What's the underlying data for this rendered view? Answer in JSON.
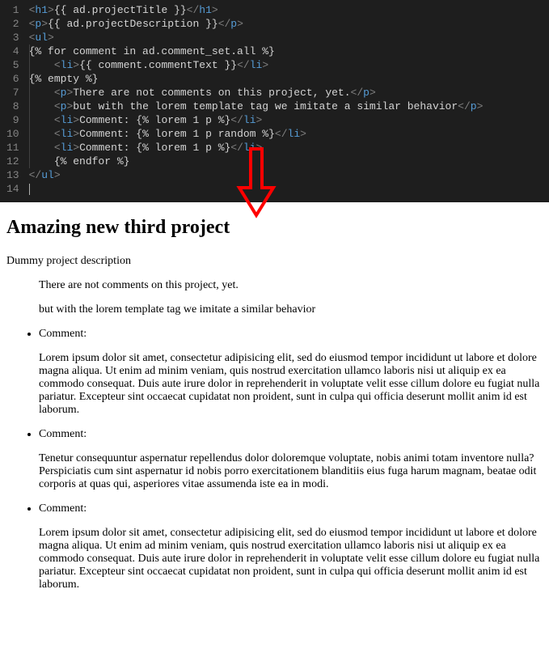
{
  "editor": {
    "lines": [
      [
        {
          "c": "delim",
          "t": "<"
        },
        {
          "c": "tag",
          "t": "h1"
        },
        {
          "c": "delim",
          "t": ">"
        },
        {
          "c": "txt",
          "t": "{{ ad.projectTitle }}"
        },
        {
          "c": "delim",
          "t": "</"
        },
        {
          "c": "tag",
          "t": "h1"
        },
        {
          "c": "delim",
          "t": ">"
        }
      ],
      [
        {
          "c": "delim",
          "t": "<"
        },
        {
          "c": "tag",
          "t": "p"
        },
        {
          "c": "delim",
          "t": ">"
        },
        {
          "c": "txt",
          "t": "{{ ad.projectDescription }}"
        },
        {
          "c": "delim",
          "t": "</"
        },
        {
          "c": "tag",
          "t": "p"
        },
        {
          "c": "delim",
          "t": ">"
        }
      ],
      [
        {
          "c": "delim",
          "t": "<"
        },
        {
          "c": "tag",
          "t": "ul"
        },
        {
          "c": "delim",
          "t": ">"
        }
      ],
      [
        {
          "c": "tmpl",
          "t": "{% for comment in ad.comment_set.all %}"
        }
      ],
      [
        {
          "c": "tmpl",
          "t": "    "
        },
        {
          "c": "delim",
          "t": "<"
        },
        {
          "c": "tag",
          "t": "li"
        },
        {
          "c": "delim",
          "t": ">"
        },
        {
          "c": "txt",
          "t": "{{ comment.commentText }}"
        },
        {
          "c": "delim",
          "t": "</"
        },
        {
          "c": "tag",
          "t": "li"
        },
        {
          "c": "delim",
          "t": ">"
        }
      ],
      [
        {
          "c": "tmpl",
          "t": "{% empty %}"
        }
      ],
      [
        {
          "c": "tmpl",
          "t": "    "
        },
        {
          "c": "delim",
          "t": "<"
        },
        {
          "c": "tag",
          "t": "p"
        },
        {
          "c": "delim",
          "t": ">"
        },
        {
          "c": "txt",
          "t": "There are not comments on this project, yet."
        },
        {
          "c": "delim",
          "t": "</"
        },
        {
          "c": "tag",
          "t": "p"
        },
        {
          "c": "delim",
          "t": ">"
        }
      ],
      [
        {
          "c": "tmpl",
          "t": "    "
        },
        {
          "c": "delim",
          "t": "<"
        },
        {
          "c": "tag",
          "t": "p"
        },
        {
          "c": "delim",
          "t": ">"
        },
        {
          "c": "txt",
          "t": "but with the lorem template tag we imitate a similar behavior"
        },
        {
          "c": "delim",
          "t": "</"
        },
        {
          "c": "tag",
          "t": "p"
        },
        {
          "c": "delim",
          "t": ">"
        }
      ],
      [
        {
          "c": "tmpl",
          "t": "    "
        },
        {
          "c": "delim",
          "t": "<"
        },
        {
          "c": "tag",
          "t": "li"
        },
        {
          "c": "delim",
          "t": ">"
        },
        {
          "c": "txt",
          "t": "Comment: {% lorem 1 p %}"
        },
        {
          "c": "delim",
          "t": "</"
        },
        {
          "c": "tag",
          "t": "li"
        },
        {
          "c": "delim",
          "t": ">"
        }
      ],
      [
        {
          "c": "tmpl",
          "t": "    "
        },
        {
          "c": "delim",
          "t": "<"
        },
        {
          "c": "tag",
          "t": "li"
        },
        {
          "c": "delim",
          "t": ">"
        },
        {
          "c": "txt",
          "t": "Comment: {% lorem 1 p random %}"
        },
        {
          "c": "delim",
          "t": "</"
        },
        {
          "c": "tag",
          "t": "li"
        },
        {
          "c": "delim",
          "t": ">"
        }
      ],
      [
        {
          "c": "tmpl",
          "t": "    "
        },
        {
          "c": "delim",
          "t": "<"
        },
        {
          "c": "tag",
          "t": "li"
        },
        {
          "c": "delim",
          "t": ">"
        },
        {
          "c": "txt",
          "t": "Comment: {% lorem 1 p %}"
        },
        {
          "c": "delim",
          "t": "</"
        },
        {
          "c": "tag",
          "t": "li"
        },
        {
          "c": "delim",
          "t": ">"
        }
      ],
      [
        {
          "c": "tmpl",
          "t": "    {% endfor %}"
        }
      ],
      [
        {
          "c": "delim",
          "t": "</"
        },
        {
          "c": "tag",
          "t": "ul"
        },
        {
          "c": "delim",
          "t": ">"
        }
      ],
      []
    ],
    "numbers": [
      "1",
      "2",
      "3",
      "4",
      "5",
      "6",
      "7",
      "8",
      "9",
      "10",
      "11",
      "12",
      "13",
      "14"
    ]
  },
  "arrow": {
    "color": "#ff0000"
  },
  "rendered": {
    "title": "Amazing new third project",
    "description": "Dummy project description",
    "noComments1": "There are not comments on this project, yet.",
    "noComments2": "but with the lorem template tag we imitate a similar behavior",
    "items": [
      {
        "label": "Comment:",
        "body": "Lorem ipsum dolor sit amet, consectetur adipisicing elit, sed do eiusmod tempor incididunt ut labore et dolore magna aliqua. Ut enim ad minim veniam, quis nostrud exercitation ullamco laboris nisi ut aliquip ex ea commodo consequat. Duis aute irure dolor in reprehenderit in voluptate velit esse cillum dolore eu fugiat nulla pariatur. Excepteur sint occaecat cupidatat non proident, sunt in culpa qui officia deserunt mollit anim id est laborum."
      },
      {
        "label": "Comment:",
        "body": "Tenetur consequuntur aspernatur repellendus dolor doloremque voluptate, nobis animi totam inventore nulla? Perspiciatis cum sint aspernatur id nobis porro exercitationem blanditiis eius fuga harum magnam, beatae odit corporis at quas qui, asperiores vitae assumenda iste ea in modi."
      },
      {
        "label": "Comment:",
        "body": "Lorem ipsum dolor sit amet, consectetur adipisicing elit, sed do eiusmod tempor incididunt ut labore et dolore magna aliqua. Ut enim ad minim veniam, quis nostrud exercitation ullamco laboris nisi ut aliquip ex ea commodo consequat. Duis aute irure dolor in reprehenderit in voluptate velit esse cillum dolore eu fugiat nulla pariatur. Excepteur sint occaecat cupidatat non proident, sunt in culpa qui officia deserunt mollit anim id est laborum."
      }
    ]
  }
}
